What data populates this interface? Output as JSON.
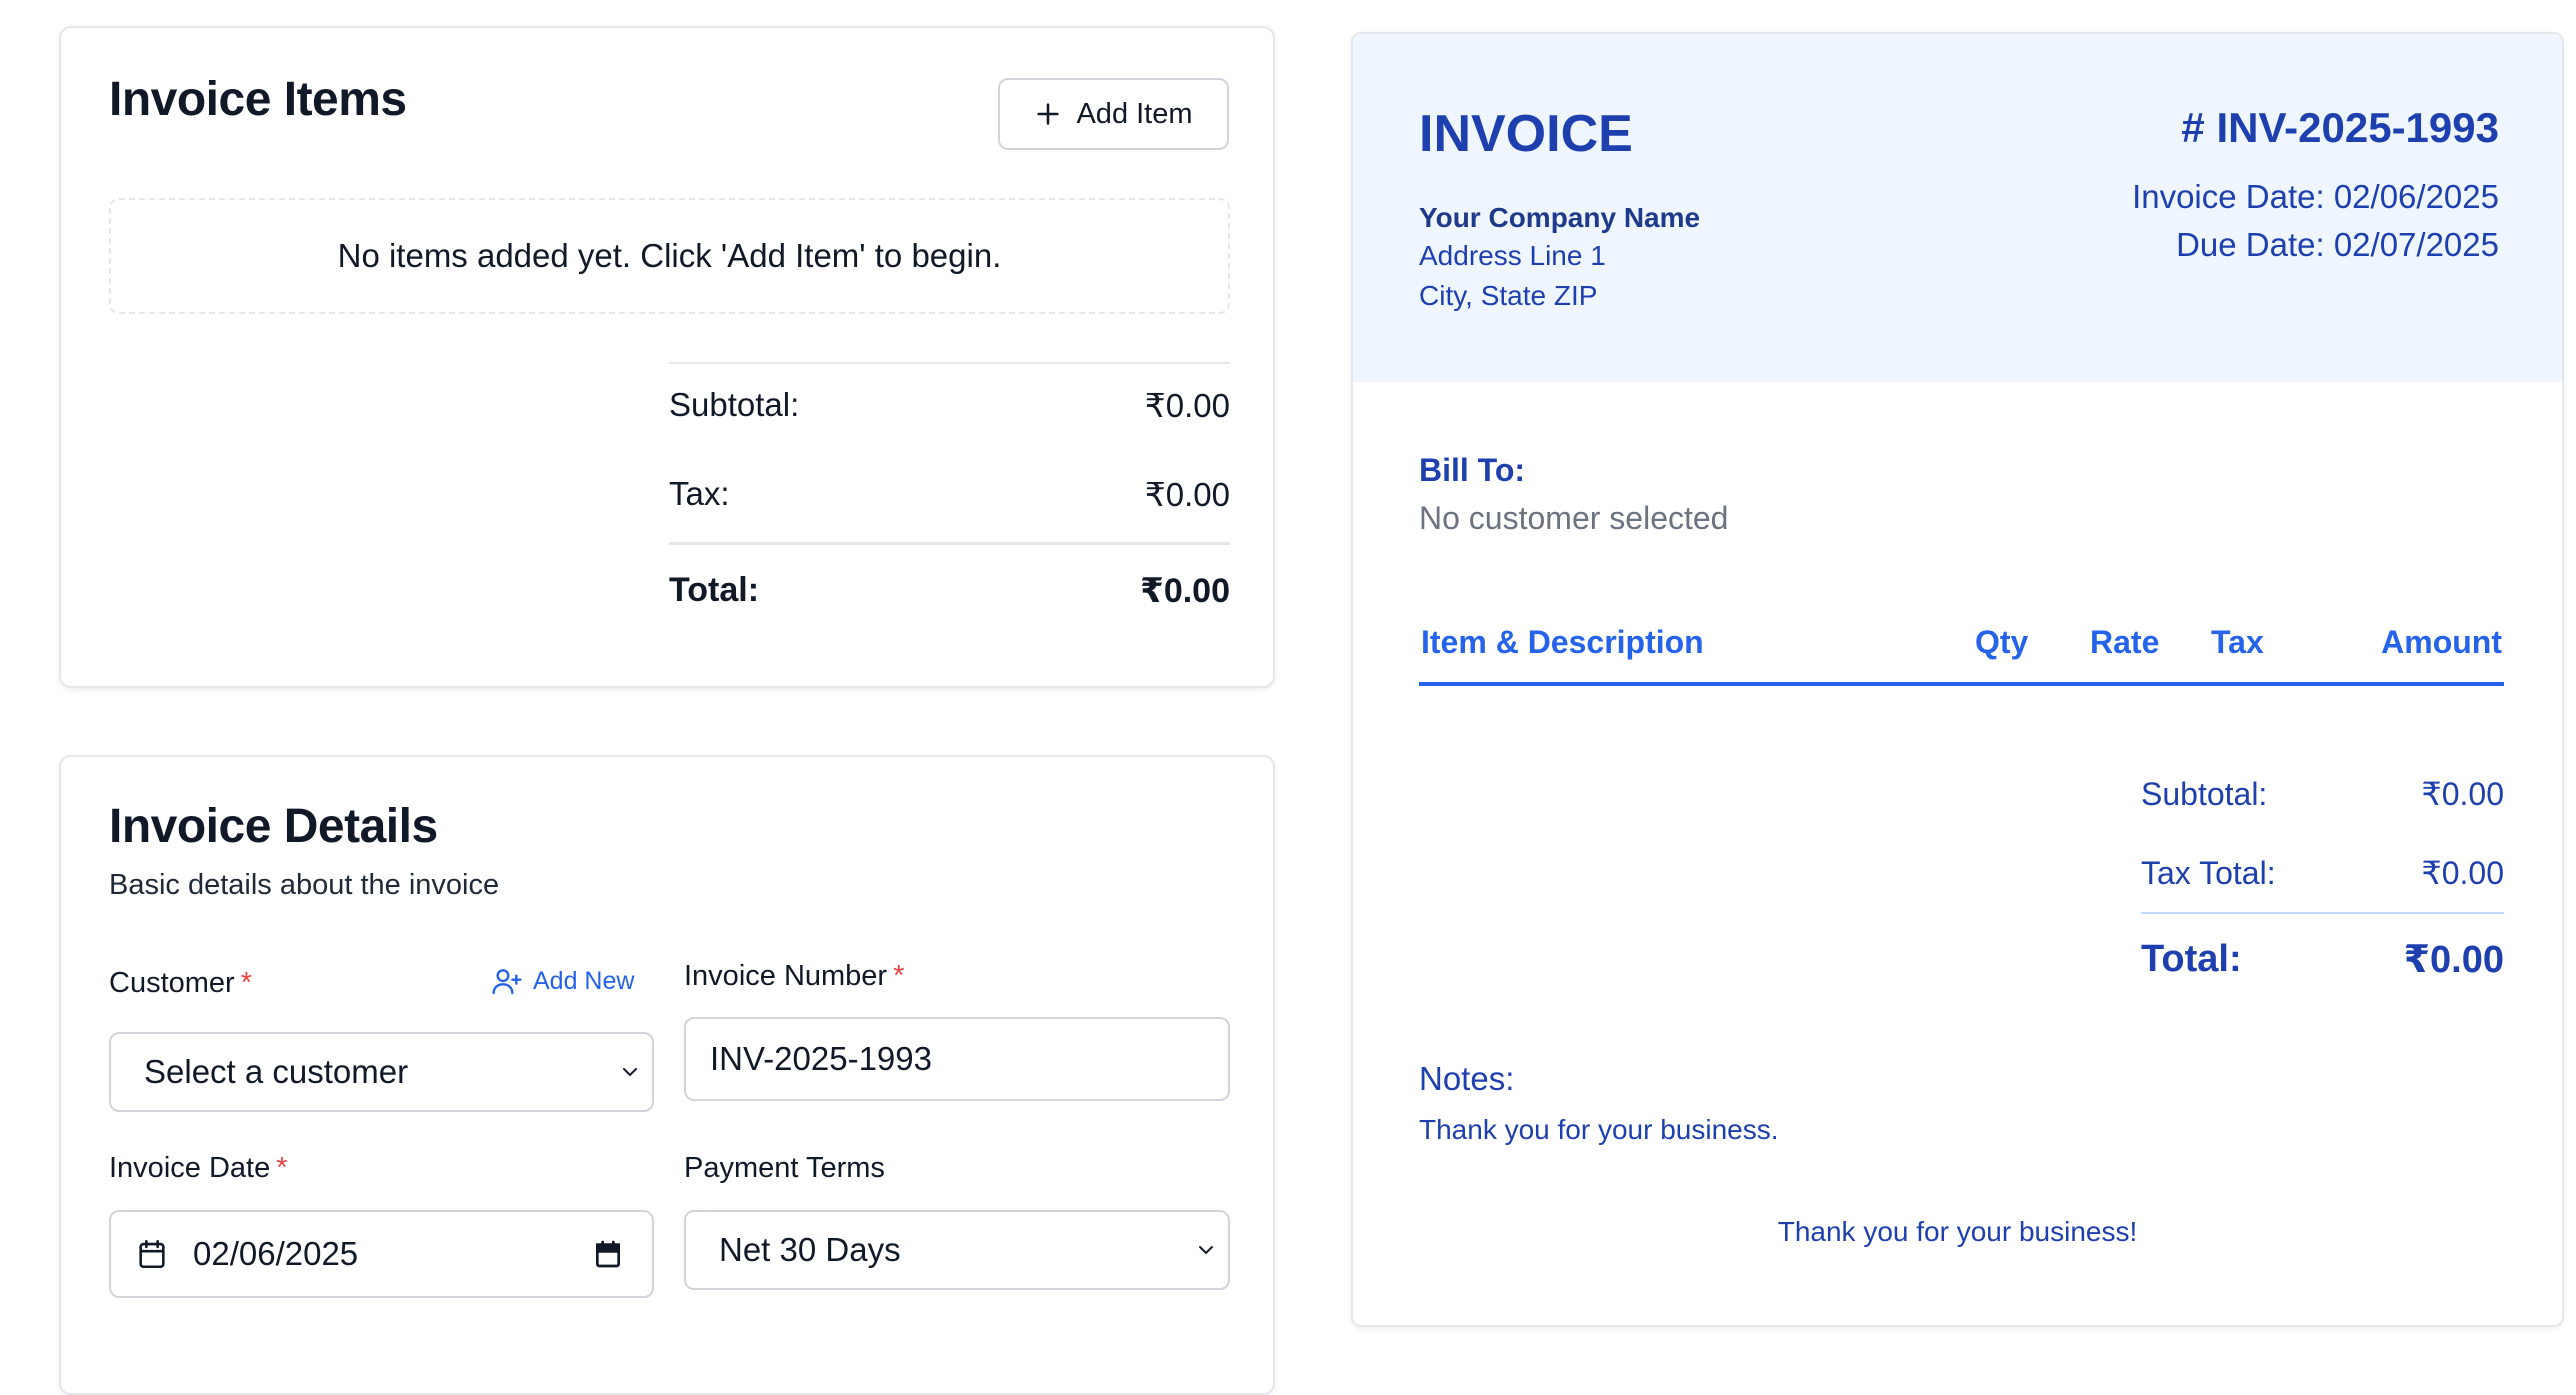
{
  "items_card": {
    "title": "Invoice Items",
    "add_item_label": "Add Item",
    "empty_message": "No items added yet. Click 'Add Item' to begin.",
    "subtotal_label": "Subtotal:",
    "subtotal_value": "₹0.00",
    "tax_label": "Tax:",
    "tax_value": "₹0.00",
    "total_label": "Total:",
    "total_value": "₹0.00"
  },
  "details_card": {
    "title": "Invoice Details",
    "subtitle": "Basic details about the invoice",
    "customer_label": "Customer",
    "required_mark": "*",
    "add_new_label": "Add New",
    "customer_value": "Select a customer",
    "invoice_number_label": "Invoice Number",
    "invoice_number_value": "INV-2025-1993",
    "invoice_date_label": "Invoice Date",
    "invoice_date_value": "02/06/2025",
    "payment_terms_label": "Payment Terms",
    "payment_terms_value": "Net 30 Days"
  },
  "preview": {
    "title": "INVOICE",
    "number": "# INV-2025-1993",
    "company_name": "Your Company Name",
    "address_line1": "Address Line 1",
    "address_line2": "City, State ZIP",
    "invoice_date": "Invoice Date: 02/06/2025",
    "due_date": "Due Date: 02/07/2025",
    "bill_to_label": "Bill To:",
    "bill_to_value": "No customer selected",
    "columns": {
      "item": "Item & Description",
      "qty": "Qty",
      "rate": "Rate",
      "tax": "Tax",
      "amount": "Amount"
    },
    "subtotal_label": "Subtotal:",
    "subtotal_value": "₹0.00",
    "tax_total_label": "Tax Total:",
    "tax_total_value": "₹0.00",
    "total_label": "Total:",
    "total_value": "₹0.00",
    "notes_label": "Notes:",
    "notes_text": "Thank you for your business.",
    "footer": "Thank you for your business!"
  },
  "colors": {
    "accent": "#2563eb",
    "preview_text": "#1e40af",
    "preview_header_bg": "#eff6ff",
    "required": "#ef4444"
  },
  "icons": [
    "plus-icon",
    "user-plus-icon",
    "chevron-down-icon",
    "calendar-icon"
  ]
}
